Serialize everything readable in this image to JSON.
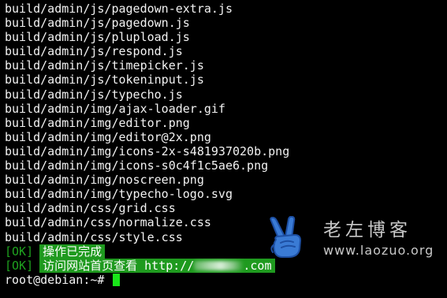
{
  "terminal": {
    "lines": [
      "build/admin/js/pagedown-extra.js",
      "build/admin/js/pagedown.js",
      "build/admin/js/plupload.js",
      "build/admin/js/respond.js",
      "build/admin/js/timepicker.js",
      "build/admin/js/tokeninput.js",
      "build/admin/js/typecho.js",
      "build/admin/img/ajax-loader.gif",
      "build/admin/img/editor.png",
      "build/admin/img/editor@2x.png",
      "build/admin/img/icons-2x-s481937020b.png",
      "build/admin/img/icons-s0c4f1c5ae6.png",
      "build/admin/img/noscreen.png",
      "build/admin/img/typecho-logo.svg",
      "build/admin/css/grid.css",
      "build/admin/css/normalize.css",
      "build/admin/css/style.css"
    ],
    "status_lines": [
      {
        "tag": "[OK]",
        "message": "操作已完成"
      },
      {
        "tag": "[OK]",
        "message_prefix": "访问网站首页查看 http://",
        "message_suffix": ".com"
      }
    ],
    "prompt": "root@debian:~#",
    "colors": {
      "background": "#000000",
      "text": "#f2f2f2",
      "ok_tag": "#1fa21f",
      "highlight": "#1f9a1f",
      "cursor": "#19e619"
    }
  },
  "watermark": {
    "title": "老左博客",
    "url": "www.laozuo.org",
    "logo_icon": "victory-hand-icon"
  }
}
